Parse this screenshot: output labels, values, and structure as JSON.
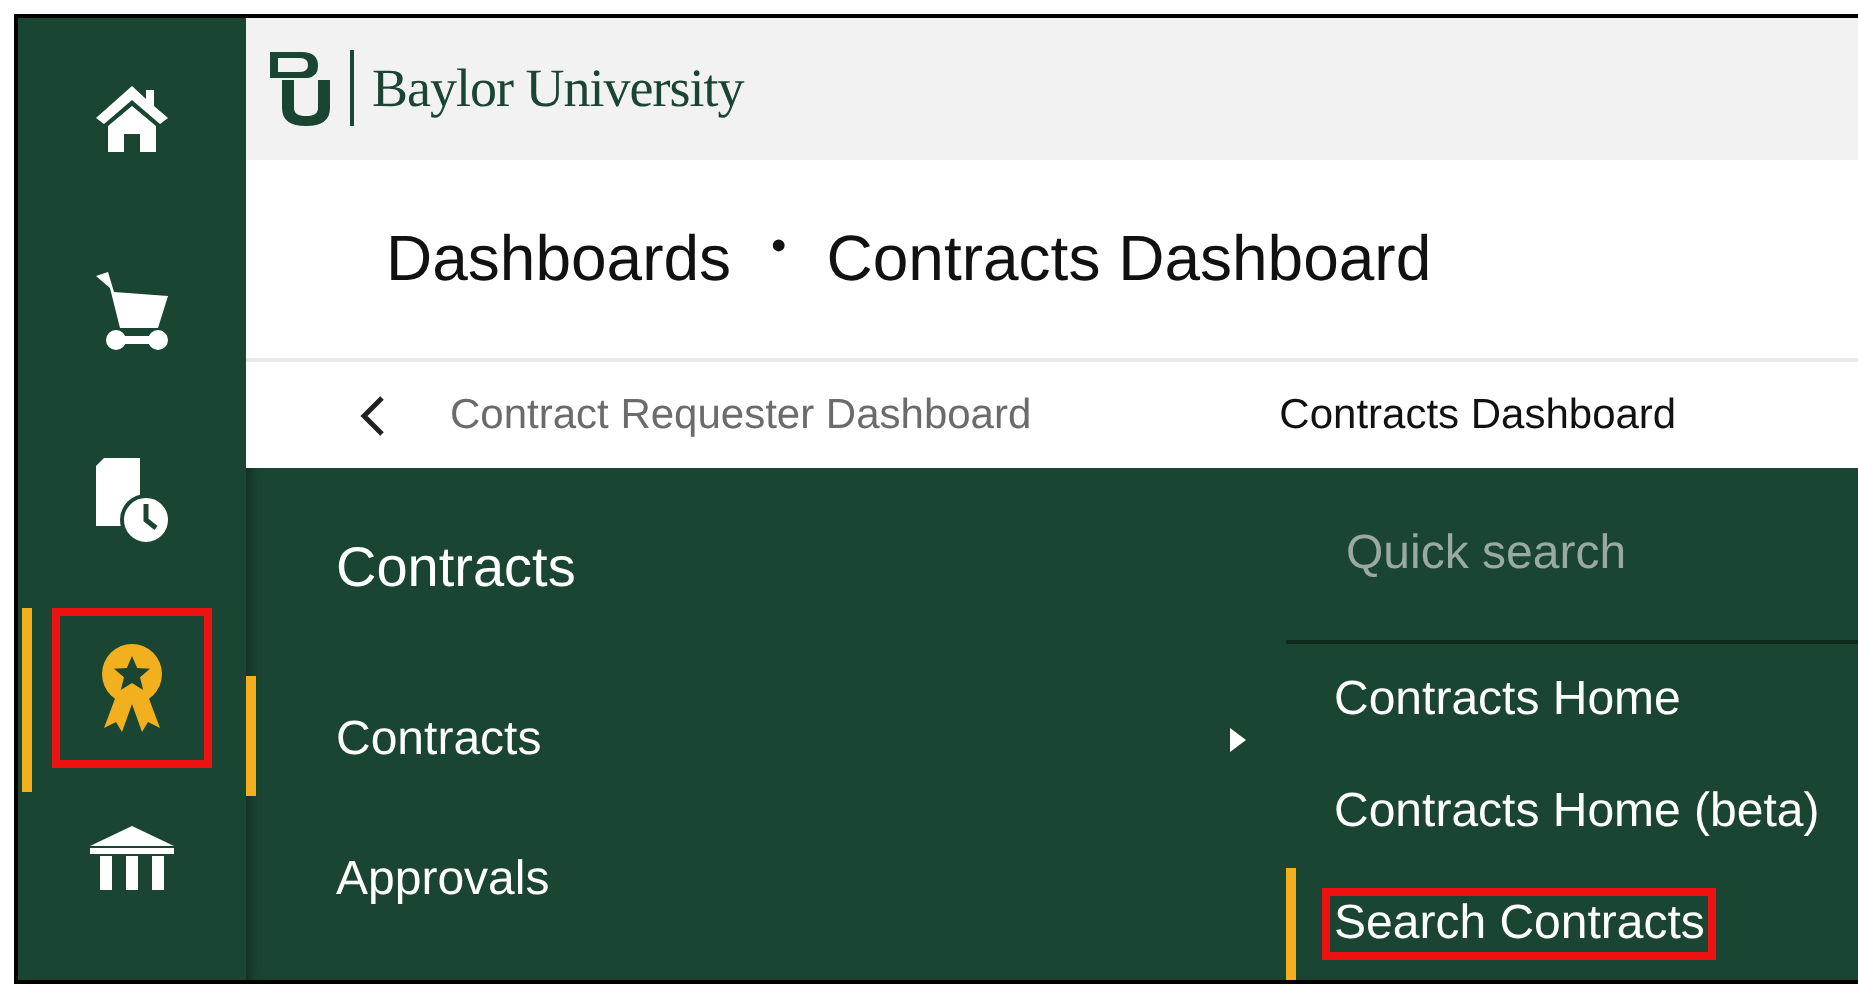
{
  "rail": [
    {
      "kind": "home",
      "selected": false,
      "highlighted": false
    },
    {
      "kind": "cart",
      "selected": false,
      "highlighted": false
    },
    {
      "kind": "document",
      "selected": false,
      "highlighted": false
    },
    {
      "kind": "award",
      "selected": true,
      "highlighted": true
    },
    {
      "kind": "bank",
      "selected": false,
      "highlighted": false
    }
  ],
  "header": {
    "logo_text": "Baylor University"
  },
  "breadcrumb": [
    "Dashboards",
    "Contracts Dashboard"
  ],
  "breadcrumb_separator": "•",
  "tabs": [
    {
      "label": "Contract Requester Dashboard",
      "selected": false
    },
    {
      "label": "Contracts Dashboard",
      "selected": true
    }
  ],
  "menu": {
    "title": "Contracts",
    "items": [
      {
        "label": "Contracts",
        "selected": true,
        "has_submenu": true
      },
      {
        "label": "Approvals",
        "selected": false,
        "has_submenu": false
      }
    ]
  },
  "submenu": {
    "search": {
      "placeholder": "Quick search"
    },
    "items": [
      {
        "label": "Contracts Home",
        "selected": false,
        "highlighted": false
      },
      {
        "label": "Contracts Home (beta)",
        "selected": false,
        "highlighted": false
      },
      {
        "label": "Search Contracts",
        "selected": true,
        "highlighted": true
      }
    ]
  }
}
